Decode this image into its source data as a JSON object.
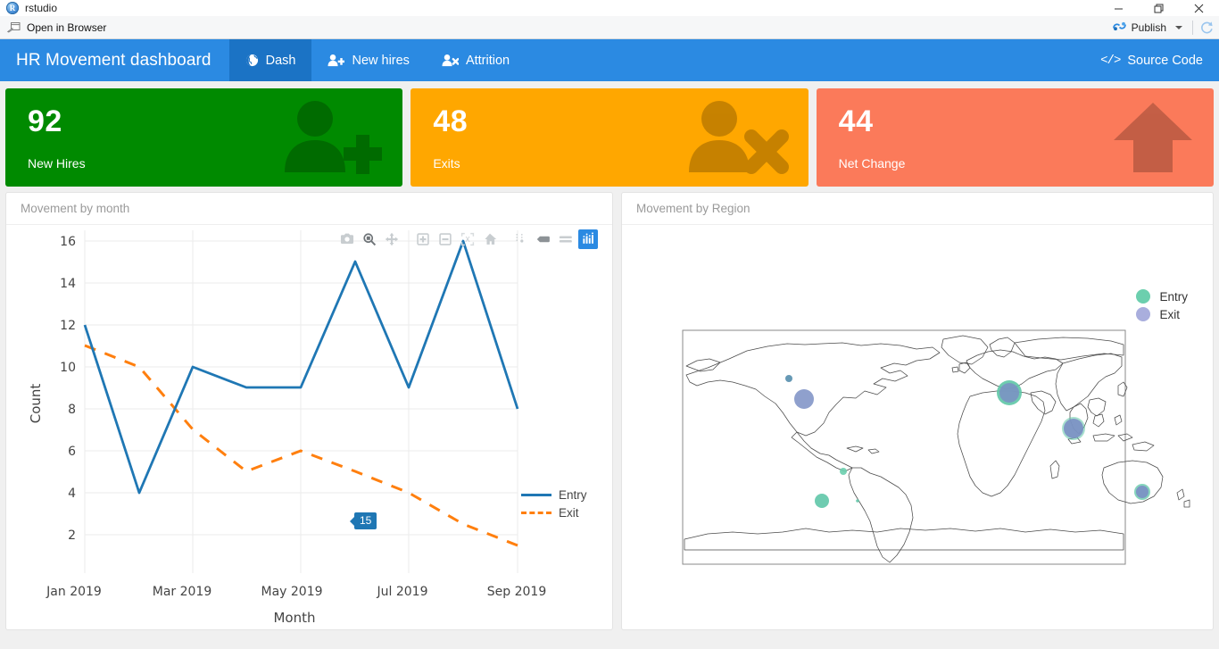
{
  "window": {
    "app_icon": "rstudio-icon",
    "title": "rstudio",
    "minimize": "—",
    "maximize": "❐",
    "close": "✕"
  },
  "toolbar": {
    "open_in_browser": "Open in Browser",
    "publish": "Publish",
    "refresh_icon": "refresh-icon",
    "dropdown_icon": "chevron-down-icon"
  },
  "navbar": {
    "brand": "HR Movement dashboard",
    "tabs": [
      {
        "label": "Dash",
        "icon": "globe-icon",
        "active": true
      },
      {
        "label": "New hires",
        "icon": "user-plus-icon",
        "active": false
      },
      {
        "label": "Attrition",
        "icon": "user-times-icon",
        "active": false
      }
    ],
    "source_code": "Source Code",
    "source_code_icon": "code-icon",
    "bg_color": "#2b8ae2",
    "active_tab_color": "#1b73c5"
  },
  "valueboxes": [
    {
      "value": "92",
      "label": "New Hires",
      "color": "#008a00",
      "icon": "user-plus-icon"
    },
    {
      "value": "48",
      "label": "Exits",
      "color": "#ffa700",
      "icon": "user-times-icon"
    },
    {
      "value": "44",
      "label": "Net Change",
      "color": "#fb7a5a",
      "icon": "arrow-up-icon"
    }
  ],
  "panels": {
    "left_title": "Movement by month",
    "right_title": "Movement by Region"
  },
  "modebar": {
    "buttons": [
      {
        "name": "camera-icon",
        "title": "Download plot as a png",
        "active": false
      },
      {
        "name": "zoom-icon",
        "title": "Zoom",
        "active": false
      },
      {
        "name": "pan-icon",
        "title": "Pan",
        "active": false
      },
      {
        "name": "zoom-in-icon",
        "title": "Zoom in",
        "active": false
      },
      {
        "name": "zoom-out-icon",
        "title": "Zoom out",
        "active": false
      },
      {
        "name": "autoscale-icon",
        "title": "Autoscale",
        "active": false
      },
      {
        "name": "home-icon",
        "title": "Reset axes",
        "active": false
      },
      {
        "name": "spike-lines-icon",
        "title": "Toggle Spike Lines",
        "active": false
      },
      {
        "name": "hover-closest-icon",
        "title": "Show closest data on hover",
        "active": false
      },
      {
        "name": "hover-compare-icon",
        "title": "Compare data on hover",
        "active": false
      },
      {
        "name": "plotly-logo-icon",
        "title": "Produced with Plotly",
        "active": true
      }
    ]
  },
  "tooltip": {
    "value": "15"
  },
  "chart_data": [
    {
      "type": "line",
      "title": "Movement by month",
      "xlabel": "Month",
      "ylabel": "Count",
      "x": [
        "Jan 2019",
        "Feb 2019",
        "Mar 2019",
        "Apr 2019",
        "May 2019",
        "Jun 2019",
        "Jul 2019",
        "Aug 2019",
        "Sep 2019"
      ],
      "tick_labels": [
        "Jan 2019",
        "Mar 2019",
        "May 2019",
        "Jul 2019",
        "Sep 2019"
      ],
      "ylim": [
        1,
        17
      ],
      "yticks": [
        2,
        4,
        6,
        8,
        10,
        12,
        14,
        16
      ],
      "grid": true,
      "legend_position": "right",
      "series": [
        {
          "name": "Entry",
          "color": "#1f77b4",
          "dash": "solid",
          "values": [
            12,
            4,
            10,
            9,
            9,
            15,
            9,
            16,
            8
          ]
        },
        {
          "name": "Exit",
          "color": "#ff7f0e",
          "dash": "dashed",
          "values": [
            11,
            9,
            7,
            5,
            6.8,
            5,
            4,
            2.8,
            1.5
          ]
        }
      ],
      "annotations": [
        {
          "text": "15",
          "x": "Jun 2019",
          "y": 15
        }
      ]
    },
    {
      "type": "scatter",
      "title": "Movement by Region",
      "projection": "world-map",
      "legend": [
        {
          "name": "Entry",
          "color": "#66cdaa"
        },
        {
          "name": "Exit",
          "color": "#a3a8d8"
        }
      ],
      "points": [
        {
          "region": "Canada",
          "series": "Exit",
          "lon": -106,
          "lat": 54,
          "size": 6
        },
        {
          "region": "United States",
          "series": "Exit",
          "lon": -98,
          "lat": 38,
          "size": 19
        },
        {
          "region": "Brazil",
          "series": "Entry",
          "lon": -50,
          "lat": -11,
          "size": 6
        },
        {
          "region": "Argentina",
          "series": "Entry",
          "lon": -62,
          "lat": -36,
          "size": 13
        },
        {
          "region": "Europe",
          "series": "Entry",
          "lon": 20,
          "lat": 50,
          "size": 24
        },
        {
          "region": "Europe",
          "series": "Exit",
          "lon": 20,
          "lat": 50,
          "size": 18
        },
        {
          "region": "India",
          "series": "Entry",
          "lon": 78,
          "lat": 22,
          "size": 21
        },
        {
          "region": "India",
          "series": "Exit",
          "lon": 78,
          "lat": 22,
          "size": 18
        },
        {
          "region": "Australia",
          "series": "Entry",
          "lon": 143,
          "lat": -27,
          "size": 15
        },
        {
          "region": "Australia",
          "series": "Exit",
          "lon": 143,
          "lat": -27,
          "size": 11
        }
      ]
    }
  ]
}
